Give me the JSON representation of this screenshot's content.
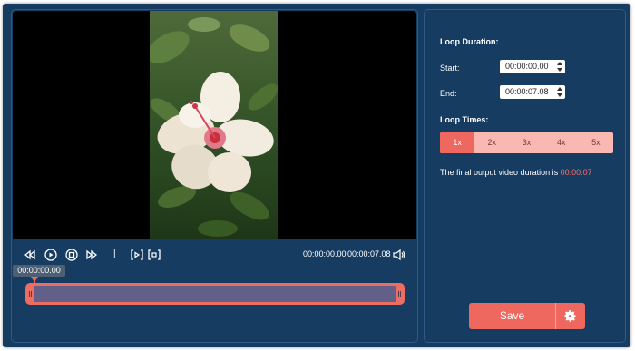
{
  "player": {
    "current_time": "00:00:00.00",
    "total_time": "00:00:07.08",
    "tooltip_time": "00:00:00.00"
  },
  "settings": {
    "loop_duration_label": "Loop Duration:",
    "start_label": "Start:",
    "start_value": "00:00:00.00",
    "end_label": "End:",
    "end_value": "00:00:07.08",
    "loop_times_label": "Loop Times:",
    "loop_options": [
      "1x",
      "2x",
      "3x",
      "4x",
      "5x"
    ],
    "selected_loop": "1x",
    "summary_prefix": "The final output video duration is ",
    "summary_value": "00:00:07"
  },
  "actions": {
    "save_label": "Save"
  },
  "colors": {
    "background": "#173c62",
    "accent": "#ee6860",
    "highlight_text": "#ff6b62",
    "loop_inactive": "#f9b8b1",
    "timeline_fill": "#625f88"
  },
  "icons": [
    "rewind-icon",
    "play-icon",
    "stop-icon",
    "forward-icon",
    "clip-start-icon",
    "clip-end-icon",
    "volume-icon",
    "gear-icon"
  ]
}
